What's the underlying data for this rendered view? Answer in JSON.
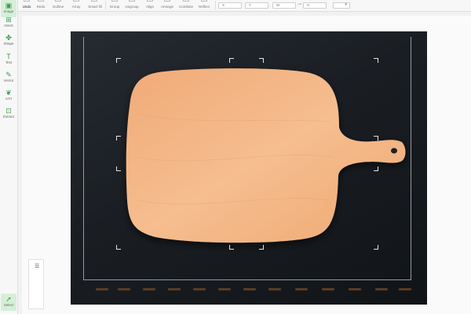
{
  "toolbar": {
    "buttons": [
      {
        "label": "Undo"
      },
      {
        "label": "Redo"
      },
      {
        "label": "Outline"
      },
      {
        "label": "Array"
      },
      {
        "label": "Smart fill"
      },
      {
        "label": "Group"
      },
      {
        "label": "Ungroup"
      },
      {
        "label": "Align"
      },
      {
        "label": "Arrange"
      },
      {
        "label": "Combine"
      },
      {
        "label": "Reflect"
      }
    ],
    "fields": {
      "x_label": "X",
      "y_label": "Y",
      "w_label": "W",
      "h_label": "H"
    }
  },
  "left_tools": [
    {
      "label": "Image",
      "icon": "image-icon",
      "glyph": "▣"
    },
    {
      "label": "Insert",
      "icon": "insert-icon",
      "glyph": "⊞"
    },
    {
      "label": "Shape",
      "icon": "shape-icon",
      "glyph": "✤"
    },
    {
      "label": "Text",
      "icon": "text-icon",
      "glyph": "T"
    },
    {
      "label": "Vector",
      "icon": "vector-icon",
      "glyph": "✎"
    },
    {
      "label": "xArt",
      "icon": "xart-icon",
      "glyph": "❦"
    },
    {
      "label": "Extract",
      "icon": "extract-icon",
      "glyph": "⊡"
    },
    {
      "label": "Select",
      "icon": "select-icon",
      "glyph": "➚"
    }
  ],
  "colors": {
    "accent": "#3c9c4e",
    "canvas_photo": "#1b1f24",
    "board_wood": "#f3b686"
  }
}
